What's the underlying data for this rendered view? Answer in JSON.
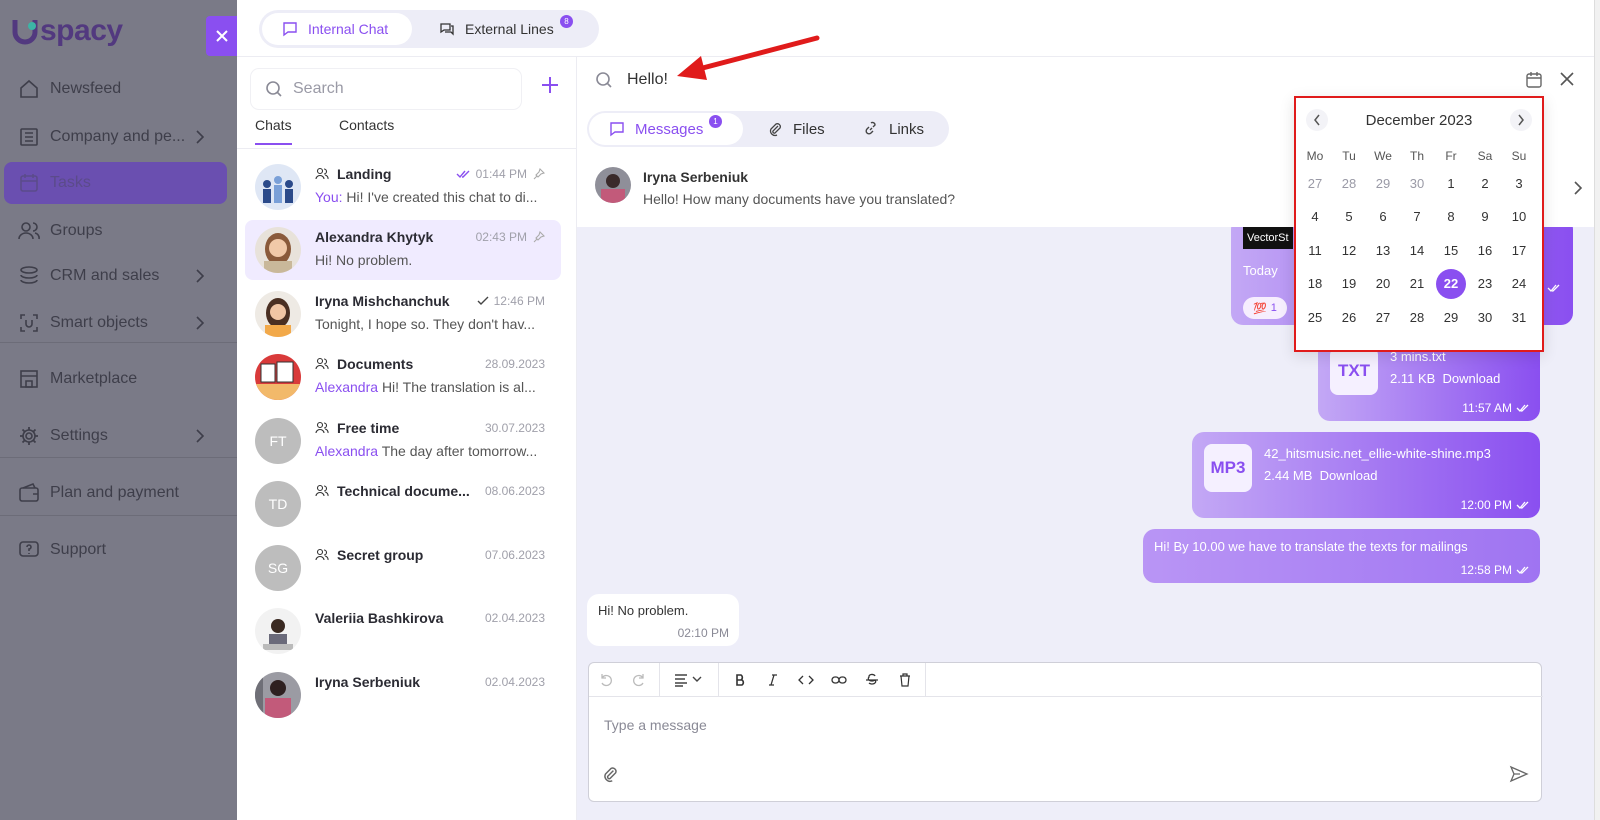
{
  "brand": {
    "logo_text": "spacy"
  },
  "sidebar": {
    "items": [
      {
        "label": "Newsfeed",
        "icon": "house-icon"
      },
      {
        "label": "Company and pe...",
        "icon": "building-icon",
        "chevron": true
      },
      {
        "label": "Tasks",
        "icon": "calendar-icon",
        "active": true
      },
      {
        "label": "Groups",
        "icon": "users-icon"
      },
      {
        "label": "CRM and sales",
        "icon": "layers-icon",
        "chevron": true
      },
      {
        "label": "Smart objects",
        "icon": "object-icon",
        "chevron": true
      },
      {
        "label": "Marketplace",
        "icon": "store-icon"
      },
      {
        "label": "Settings",
        "icon": "gear-icon",
        "chevron": true
      },
      {
        "label": "Plan and payment",
        "icon": "wallet-icon"
      },
      {
        "label": "Support",
        "icon": "help-icon"
      }
    ]
  },
  "top_tabs": [
    {
      "label": "Internal Chat",
      "active": true
    },
    {
      "label": "External Lines",
      "badge": "8"
    }
  ],
  "chat_panel": {
    "search_placeholder": "Search",
    "tabs": [
      "Chats",
      "Contacts"
    ],
    "chats": [
      {
        "name": "Landing",
        "group": true,
        "time": "01:44 PM",
        "read": "double",
        "pinned": true,
        "sender": "You:",
        "message": "Hi! I've created this chat to di...",
        "avatar": "photo-group"
      },
      {
        "name": "Alexandra Khytyk",
        "time": "02:43 PM",
        "pinned": true,
        "message": "Hi! No problem.",
        "avatar": "photo-woman",
        "selected": true
      },
      {
        "name": "Iryna Mishchanchuk",
        "time": "12:46 PM",
        "read": "single",
        "message": "Tonight, I hope so. They don't hav...",
        "avatar": "photo-woman2"
      },
      {
        "name": "Documents",
        "group": true,
        "time": "28.09.2023",
        "sender": "Alexandra",
        "message": "Hi! The translation is al...",
        "avatar": "photo-docs"
      },
      {
        "name": "Free time",
        "group": true,
        "time": "30.07.2023",
        "sender": "Alexandra",
        "message": "The day after tomorrow...",
        "initials": "FT"
      },
      {
        "name": "Technical docume...",
        "group": true,
        "time": "08.06.2023",
        "message": "",
        "initials": "TD"
      },
      {
        "name": "Secret group",
        "group": true,
        "time": "07.06.2023",
        "message": "",
        "initials": "SG"
      },
      {
        "name": "Valeriia Bashkirova",
        "time": "02.04.2023",
        "message": "",
        "avatar": "photo-woman3"
      },
      {
        "name": "Iryna Serbeniuk",
        "time": "02.04.2023",
        "message": "",
        "avatar": "photo-woman4"
      }
    ]
  },
  "main": {
    "search_value": "Hello!",
    "filter_tabs": [
      {
        "label": "Messages",
        "badge": "1",
        "active": true
      },
      {
        "label": "Files"
      },
      {
        "label": "Links"
      }
    ],
    "result": {
      "name": "Iryna Serbeniuk",
      "text": "Hello! How many documents have you translated?"
    },
    "partial_bubble": {
      "brand": "VectorSt",
      "text": "Today",
      "reaction": "💯",
      "reaction_count": "1"
    },
    "messages": [
      {
        "type": "file",
        "ext": "TXT",
        "name": "3 mins.txt",
        "size": "2.11 KB",
        "action": "Download",
        "time": "11:57 AM"
      },
      {
        "type": "file",
        "ext": "MP3",
        "name": "42_hitsmusic.net_ellie-white-shine.mp3",
        "size": "2.44 MB",
        "action": "Download",
        "time": "12:00 PM"
      },
      {
        "type": "text",
        "text": "Hi! By 10.00 we have to translate the texts for mailings",
        "time": "12:58 PM"
      },
      {
        "type": "incoming",
        "text": "Hi! No problem.",
        "time": "02:10 PM"
      }
    ],
    "composer": {
      "placeholder": "Type a message"
    }
  },
  "calendar": {
    "title": "December 2023",
    "weekdays": [
      "Mo",
      "Tu",
      "We",
      "Th",
      "Fr",
      "Sa",
      "Su"
    ],
    "weeks": [
      [
        "27",
        "28",
        "29",
        "30",
        "1",
        "2",
        "3"
      ],
      [
        "4",
        "5",
        "6",
        "7",
        "8",
        "9",
        "10"
      ],
      [
        "11",
        "12",
        "13",
        "14",
        "15",
        "16",
        "17"
      ],
      [
        "18",
        "19",
        "20",
        "21",
        "22",
        "23",
        "24"
      ],
      [
        "25",
        "26",
        "27",
        "28",
        "29",
        "30",
        "31"
      ]
    ],
    "selected": "22"
  },
  "colors": {
    "accent": "#8a4ff0",
    "annotation": "#e01b1b"
  }
}
